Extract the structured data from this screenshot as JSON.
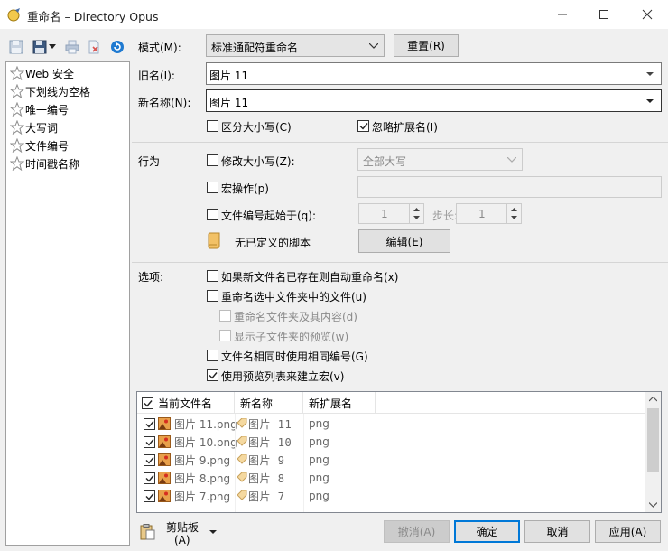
{
  "window": {
    "title": "重命名 – Directory Opus"
  },
  "presets": [
    {
      "label": "Web 安全"
    },
    {
      "label": "下划线为空格"
    },
    {
      "label": "唯一编号"
    },
    {
      "label": "大写词"
    },
    {
      "label": "文件编号"
    },
    {
      "label": "时间戳名称"
    }
  ],
  "mode": {
    "label": "模式(M):",
    "value": "标准通配符重命名",
    "reset_label": "重置(R)"
  },
  "old_name": {
    "label": "旧名(I):",
    "value": "图片 11"
  },
  "new_name": {
    "label": "新名称(N):",
    "value": "图片 11"
  },
  "options_top": {
    "case_sensitive": {
      "label": "区分大小写(C)",
      "checked": false
    },
    "ignore_ext": {
      "label": "忽略扩展名(I)",
      "checked": true
    }
  },
  "behavior": {
    "section_label": "行为",
    "modify_case": {
      "label": "修改大小写(Z):",
      "checked": false,
      "value": "全部大写"
    },
    "macro": {
      "label": "宏操作(p)",
      "checked": false
    },
    "numbering": {
      "label": "文件编号起始于(q):",
      "checked": false,
      "start": "1",
      "step_label": "步长:",
      "step": "1"
    },
    "script": {
      "label": "无已定义的脚本",
      "edit_label": "编辑(E)"
    }
  },
  "options": {
    "section_label": "选项:",
    "items": [
      {
        "label": "如果新文件名已存在则自动重命名(x)",
        "checked": false,
        "disabled": false
      },
      {
        "label": "重命名选中文件夹中的文件(u)",
        "checked": false,
        "disabled": false
      },
      {
        "label": "重命名文件夹及其内容(d)",
        "checked": false,
        "disabled": true
      },
      {
        "label": "显示子文件夹的预览(w)",
        "checked": false,
        "disabled": true
      },
      {
        "label": "文件名相同时使用相同编号(G)",
        "checked": false,
        "disabled": false
      },
      {
        "label": "使用预览列表来建立宏(v)",
        "checked": true,
        "disabled": false
      }
    ]
  },
  "preview": {
    "columns": [
      "当前文件名",
      "新名称",
      "新扩展名"
    ],
    "rows": [
      {
        "current": "图片 11.png",
        "new_name": "图片 11",
        "ext": "png"
      },
      {
        "current": "图片 10.png",
        "new_name": "图片 10",
        "ext": "png"
      },
      {
        "current": "图片 9.png",
        "new_name": "图片 9",
        "ext": "png"
      },
      {
        "current": "图片 8.png",
        "new_name": "图片 8",
        "ext": "png"
      },
      {
        "current": "图片 7.png",
        "new_name": "图片 7",
        "ext": "png"
      }
    ]
  },
  "footer": {
    "clipboard_label": "剪贴板",
    "clipboard_sub": "(A)",
    "undo_label": "撤消(A)",
    "ok_label": "确定",
    "cancel_label": "取消",
    "apply_label": "应用(A)"
  },
  "colors": {
    "accent": "#0078d7",
    "window_bg": "#f0f0f0"
  }
}
